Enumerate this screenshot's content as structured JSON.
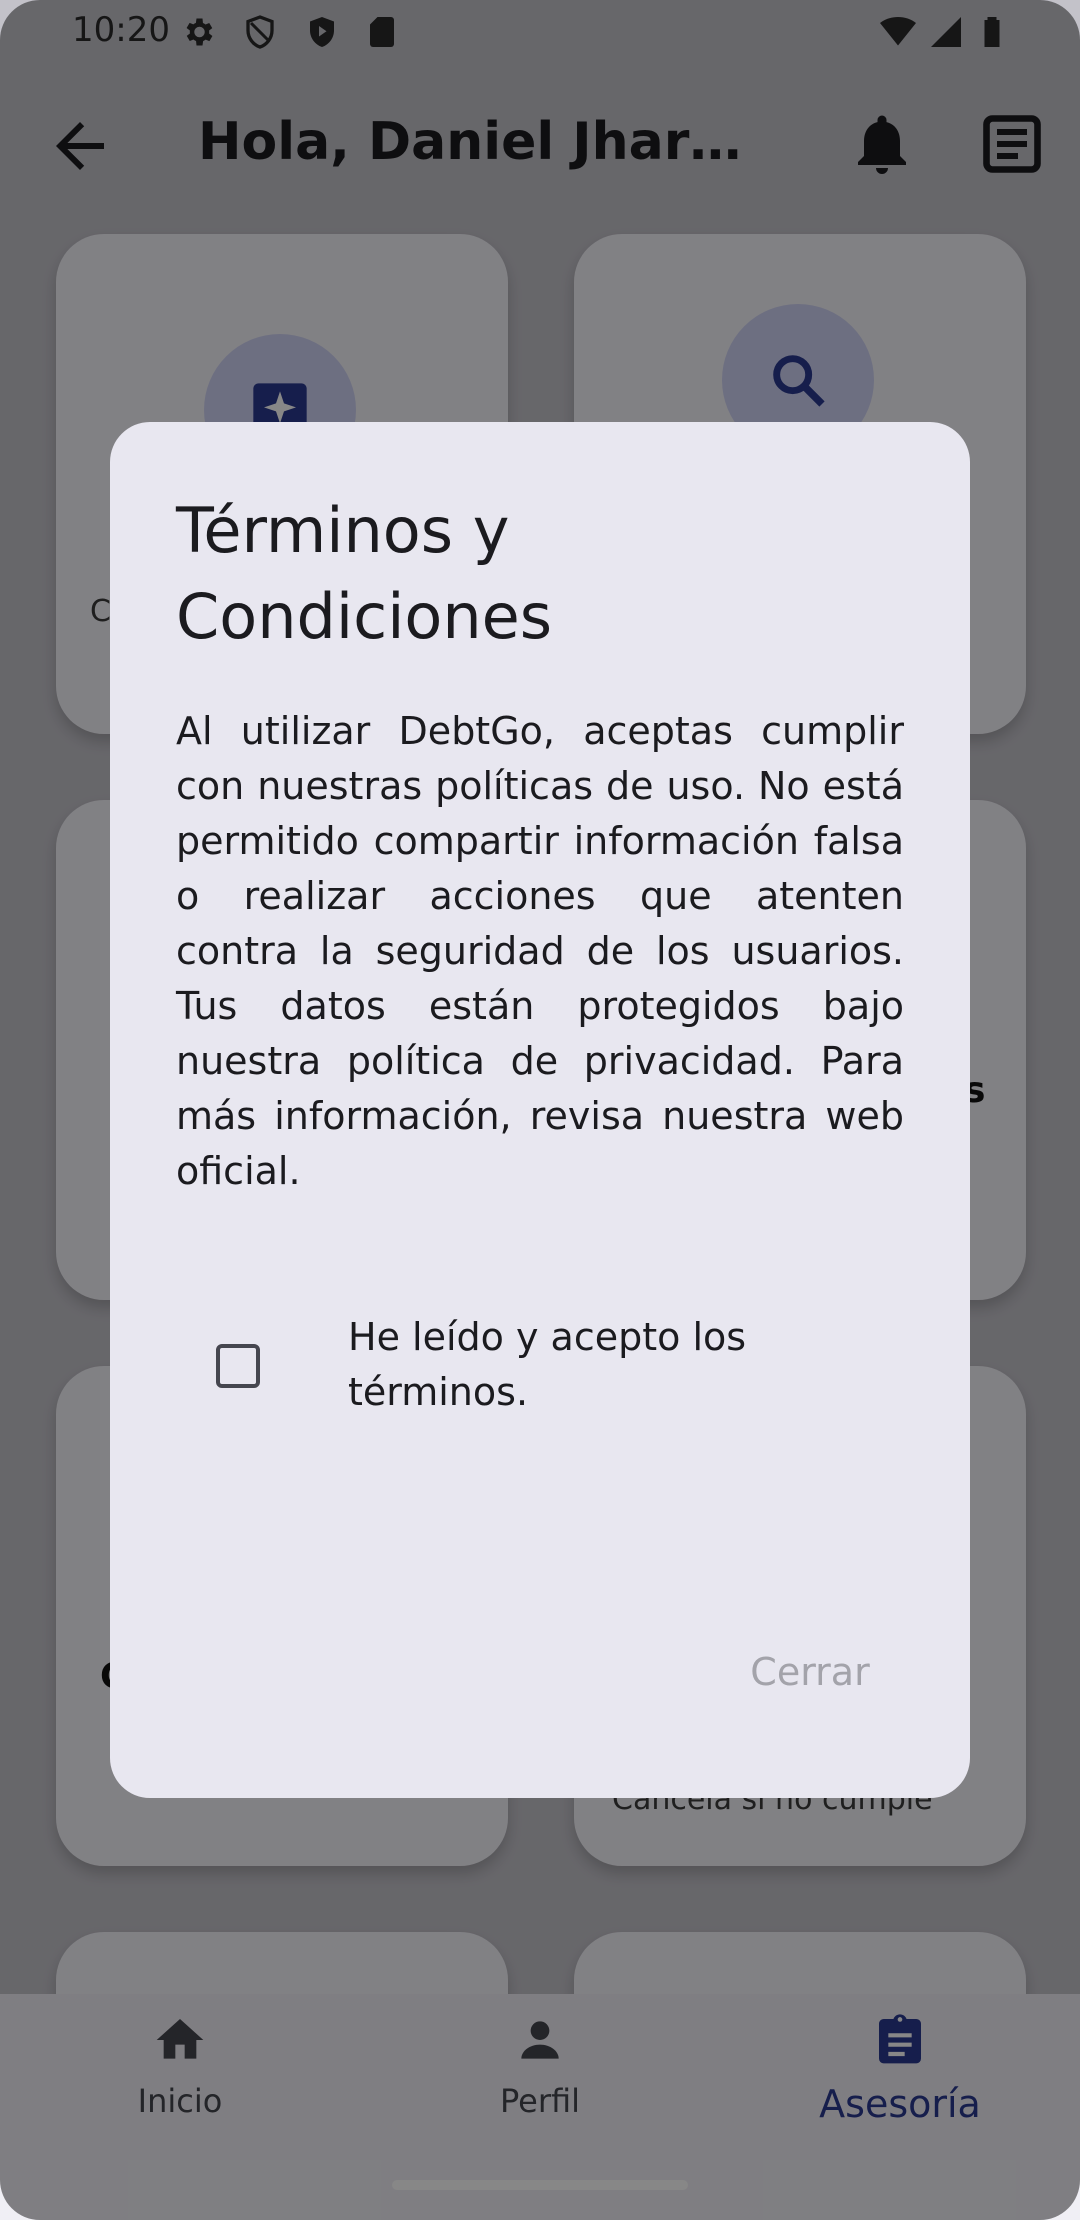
{
  "status_bar": {
    "time": "10:20"
  },
  "app_bar": {
    "title": "Hola, Daniel Jhared..."
  },
  "background_cards": [
    {
      "text": "C"
    },
    {
      "text": "s"
    },
    {
      "text": "C"
    },
    {
      "text": "Cancela si no cumple"
    }
  ],
  "bottom_nav": {
    "items": [
      {
        "label": "Inicio",
        "icon": "home-icon"
      },
      {
        "label": "Perfil",
        "icon": "person-icon"
      },
      {
        "label": "Asesoría",
        "icon": "clipboard-icon",
        "active": true
      }
    ]
  },
  "dialog": {
    "title": "Términos y Condiciones",
    "body": "Al utilizar DebtGo, aceptas cumplir con nuestras políticas de uso. No está permitido compartir información falsa o realizar acciones que atenten contra la seguridad de los usuarios. Tus datos están protegidos bajo nuestra política de privacidad. Para más información, revisa nuestra web oficial.",
    "checkbox_label": "He leído y acepto los términos.",
    "checkbox_checked": false,
    "close_label": "Cerrar"
  },
  "colors": {
    "accent": "#2b3a90",
    "dialog_bg": "#e8e7f0",
    "disabled_text": "#a3a3aa"
  }
}
